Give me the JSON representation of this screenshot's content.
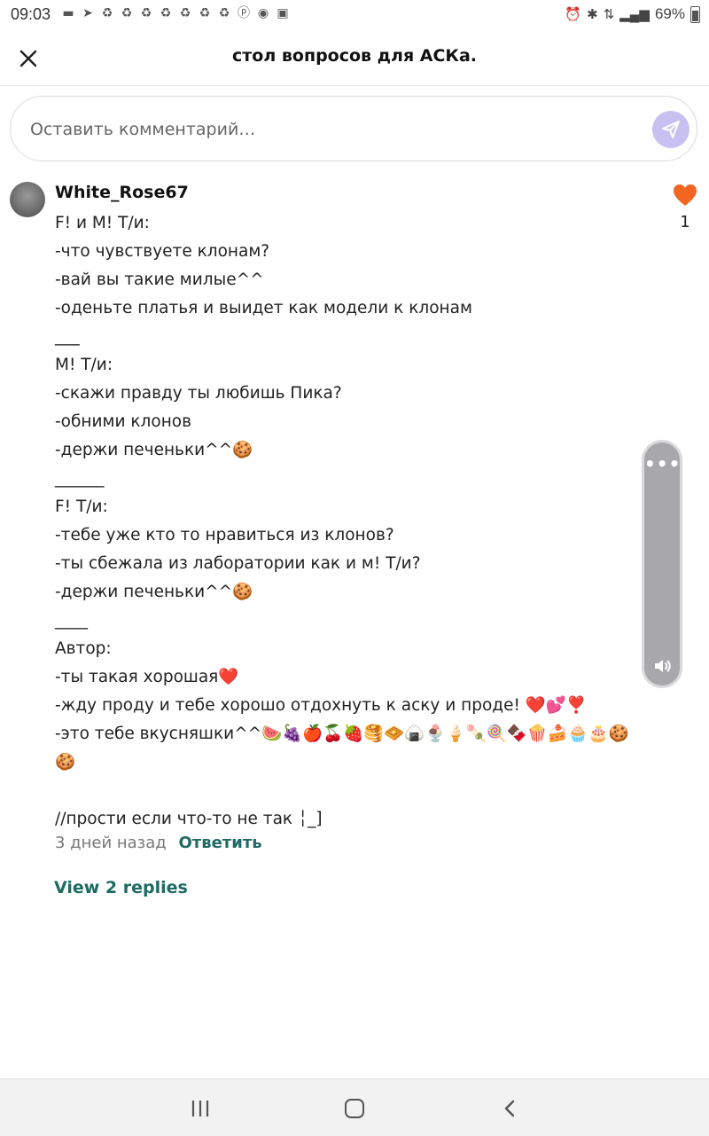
{
  "status_bar": {
    "time": "09:03",
    "battery": "69%",
    "notification_icons": [
      "chat-icon",
      "telegram-icon",
      "recycle-icon",
      "recycle-icon",
      "recycle-icon",
      "recycle-icon",
      "recycle-icon",
      "recycle-icon",
      "recycle-icon",
      "pinterest-icon",
      "speech-icon",
      "wb-icon"
    ],
    "right_icons": [
      "alarm-icon",
      "bluetooth-icon",
      "data-icon",
      "signal-icon"
    ]
  },
  "header": {
    "title": "стол вопросов для АСКа."
  },
  "comment_input": {
    "placeholder": "Оставить комментарий…"
  },
  "comment": {
    "username": "White_Rose67",
    "likes": "1",
    "lines": [
      "F! и M! Т/и:",
      "-что чувствуете клонам?",
      "-вай вы такие милые^^",
      "-оденьте платья и выидет как модели к клонам",
      "___",
      "M! Т/и:",
      "-скажи правду ты любишь Пика?",
      "-обними клонов",
      "-держи печеньки^^🍪",
      "______",
      "F! Т/и:",
      "-тебе уже кто то нравиться из клонов?",
      "-ты сбежала из лаборатории как и м! Т/и?",
      "-держи печеньки^^🍪",
      "____",
      "Автор:",
      "-ты такая хорошая❤️",
      "-жду проду и тебе хорошо отдохнуть к аску и проде! ❤️💕❣️",
      "-это тебе вкусняшки^^🍉🍇🍎🍒🍓🥞🧇🍙🍨🍦🍡🍭🍫🍿🍰🧁🎂🍪",
      "🍪",
      "",
      "//прости если что-то не так ╎_]"
    ],
    "time_ago": "3 дней назад",
    "reply_label": "Ответить",
    "view_replies_label": "View 2 replies"
  },
  "colors": {
    "accent_teal": "#1d6b63",
    "like_orange": "#f26522",
    "send_button": "#c9c0f2"
  }
}
